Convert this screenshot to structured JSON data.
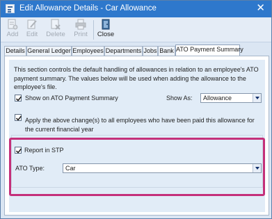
{
  "window": {
    "title": "Edit Allowance Details - Car Allowance",
    "close_glyph": "✕"
  },
  "toolbar": {
    "add": "Add",
    "edit": "Edit",
    "delete": "Delete",
    "print": "Print",
    "close": "Close"
  },
  "tabs": [
    "Details",
    "General Ledger",
    "Employees",
    "Departments",
    "Jobs",
    "Bank",
    "ATO Payment Summary"
  ],
  "active_tab": "ATO Payment Summary",
  "content": {
    "description": "This section controls the default handling of allowances in relation to an employee's ATO payment summary. The values below will be used when adding the allowance to the employee's file.",
    "show_on_summary_label": "Show on ATO Payment Summary",
    "show_on_summary_checked": true,
    "show_as_label": "Show As:",
    "show_as_value": "Allowance",
    "apply_label": "Apply the above change(s) to all employees who have been paid this allowance for the current financial year",
    "apply_checked": true,
    "report_stp_label": "Report in STP",
    "report_stp_checked": true,
    "ato_type_label": "ATO Type:",
    "ato_type_value": "Car"
  },
  "colors": {
    "titlebar": "#2e78cc",
    "highlight": "#c4307a",
    "panel": "#e1ecf7"
  },
  "icons": {
    "app": "window-form-icon",
    "add": "add-document-icon",
    "edit": "edit-pencil-icon",
    "delete": "delete-icon",
    "print": "printer-icon",
    "close": "close-door-icon"
  }
}
